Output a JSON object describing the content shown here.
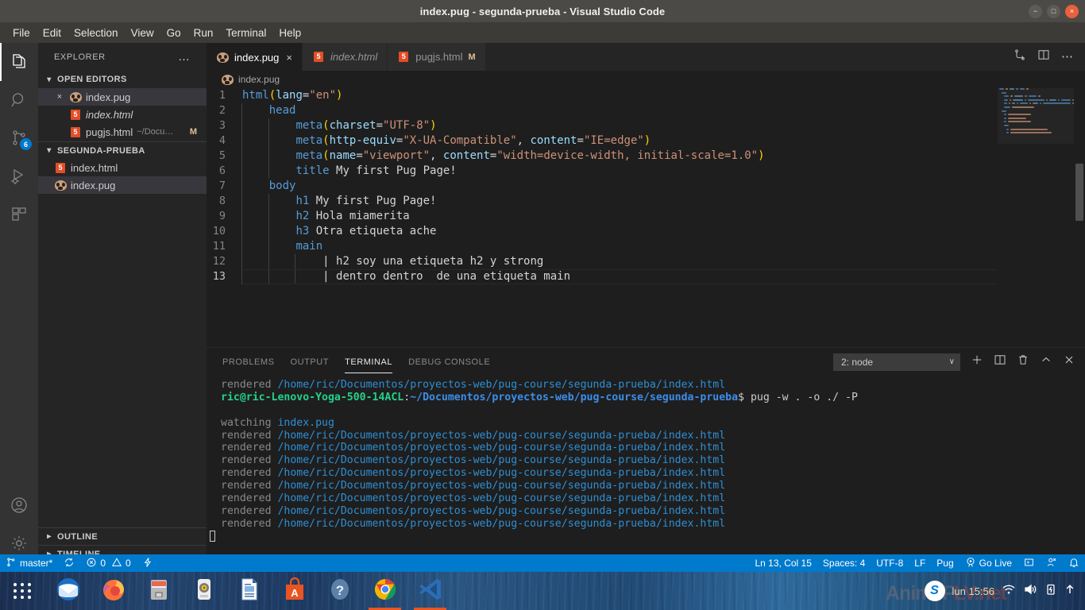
{
  "window": {
    "title": "index.pug - segunda-prueba - Visual Studio Code",
    "minimize": "−",
    "maximize": "□",
    "close": "×"
  },
  "menubar": {
    "items": [
      "File",
      "Edit",
      "Selection",
      "View",
      "Go",
      "Run",
      "Terminal",
      "Help"
    ]
  },
  "activitybar": {
    "items": [
      {
        "name": "explorer",
        "icon": "files-icon",
        "active": true,
        "badge": ""
      },
      {
        "name": "search",
        "icon": "search-icon",
        "active": false,
        "badge": ""
      },
      {
        "name": "source-control",
        "icon": "source-control-icon",
        "active": false,
        "badge": "6"
      },
      {
        "name": "run-and-debug",
        "icon": "run-debug-icon",
        "active": false,
        "badge": ""
      },
      {
        "name": "extensions",
        "icon": "extensions-icon",
        "active": false,
        "badge": ""
      }
    ],
    "bottom": [
      {
        "name": "accounts",
        "icon": "account-icon"
      },
      {
        "name": "settings",
        "icon": "gear-icon"
      }
    ]
  },
  "sidebar": {
    "title": "EXPLORER",
    "more_actions": "…",
    "open_editors": {
      "label": "OPEN EDITORS",
      "items": [
        {
          "name": "index.pug",
          "icon": "pug-icon",
          "selected": true,
          "italic": false,
          "close": "×",
          "detail": "",
          "badge": ""
        },
        {
          "name": "index.html",
          "icon": "html-icon",
          "selected": false,
          "italic": true,
          "close": "",
          "detail": "",
          "badge": ""
        },
        {
          "name": "pugjs.html",
          "icon": "html-icon",
          "selected": false,
          "italic": false,
          "close": "",
          "detail": "~/Docu…",
          "badge": "M"
        }
      ]
    },
    "folder": {
      "label": "SEGUNDA-PRUEBA",
      "items": [
        {
          "name": "index.html",
          "icon": "html-icon",
          "selected": false
        },
        {
          "name": "index.pug",
          "icon": "pug-icon",
          "selected": true
        }
      ]
    },
    "outline_label": "OUTLINE",
    "timeline_label": "TIMELINE"
  },
  "editor": {
    "tabs": [
      {
        "label": "index.pug",
        "icon": "pug-icon",
        "active": true,
        "italic": false,
        "close": "×",
        "modified": ""
      },
      {
        "label": "index.html",
        "icon": "html-icon",
        "active": false,
        "italic": true,
        "close": "",
        "modified": ""
      },
      {
        "label": "pugjs.html",
        "icon": "html-icon",
        "active": false,
        "italic": false,
        "close": "",
        "modified": "M"
      }
    ],
    "actions": [
      "split-terminal-icon",
      "split-editor-icon",
      "more-actions-icon"
    ],
    "breadcrumb": "index.pug",
    "language": "Pug",
    "lines": [
      {
        "n": 1,
        "indent": 0,
        "tokens": [
          {
            "t": "tag",
            "v": "html"
          },
          {
            "t": "paren",
            "v": "("
          },
          {
            "t": "attr",
            "v": "lang"
          },
          {
            "t": "punc",
            "v": "="
          },
          {
            "t": "str",
            "v": "\"en\""
          },
          {
            "t": "paren",
            "v": ")"
          }
        ]
      },
      {
        "n": 2,
        "indent": 1,
        "tokens": [
          {
            "t": "tag",
            "v": "head"
          }
        ]
      },
      {
        "n": 3,
        "indent": 2,
        "tokens": [
          {
            "t": "tag",
            "v": "meta"
          },
          {
            "t": "paren",
            "v": "("
          },
          {
            "t": "attr",
            "v": "charset"
          },
          {
            "t": "punc",
            "v": "="
          },
          {
            "t": "str",
            "v": "\"UTF-8\""
          },
          {
            "t": "paren",
            "v": ")"
          }
        ]
      },
      {
        "n": 4,
        "indent": 2,
        "tokens": [
          {
            "t": "tag",
            "v": "meta"
          },
          {
            "t": "paren",
            "v": "("
          },
          {
            "t": "attr",
            "v": "http-equiv"
          },
          {
            "t": "punc",
            "v": "="
          },
          {
            "t": "str",
            "v": "\"X-UA-Compatible\""
          },
          {
            "t": "punc",
            "v": ", "
          },
          {
            "t": "attr",
            "v": "content"
          },
          {
            "t": "punc",
            "v": "="
          },
          {
            "t": "str",
            "v": "\"IE=edge\""
          },
          {
            "t": "paren",
            "v": ")"
          }
        ]
      },
      {
        "n": 5,
        "indent": 2,
        "tokens": [
          {
            "t": "tag",
            "v": "meta"
          },
          {
            "t": "paren",
            "v": "("
          },
          {
            "t": "attr",
            "v": "name"
          },
          {
            "t": "punc",
            "v": "="
          },
          {
            "t": "str",
            "v": "\"viewport\""
          },
          {
            "t": "punc",
            "v": ", "
          },
          {
            "t": "attr",
            "v": "content"
          },
          {
            "t": "punc",
            "v": "="
          },
          {
            "t": "str",
            "v": "\"width=device-width, initial-scale=1.0\""
          },
          {
            "t": "paren",
            "v": ")"
          }
        ]
      },
      {
        "n": 6,
        "indent": 2,
        "tokens": [
          {
            "t": "tag",
            "v": "title"
          },
          {
            "t": "txt",
            "v": " My first Pug Page!"
          }
        ]
      },
      {
        "n": 7,
        "indent": 1,
        "tokens": [
          {
            "t": "tag",
            "v": "body"
          }
        ]
      },
      {
        "n": 8,
        "indent": 2,
        "tokens": [
          {
            "t": "tag",
            "v": "h1"
          },
          {
            "t": "txt",
            "v": " My first Pug Page!"
          }
        ]
      },
      {
        "n": 9,
        "indent": 2,
        "tokens": [
          {
            "t": "tag",
            "v": "h2"
          },
          {
            "t": "txt",
            "v": " Hola miamerita"
          }
        ]
      },
      {
        "n": 10,
        "indent": 2,
        "tokens": [
          {
            "t": "tag",
            "v": "h3"
          },
          {
            "t": "txt",
            "v": " Otra etiqueta ache"
          }
        ]
      },
      {
        "n": 11,
        "indent": 2,
        "tokens": [
          {
            "t": "tag",
            "v": "main"
          }
        ]
      },
      {
        "n": 12,
        "indent": 3,
        "tokens": [
          {
            "t": "pipe",
            "v": "| "
          },
          {
            "t": "txt",
            "v": "h2 soy una etiqueta h2 y strong"
          }
        ]
      },
      {
        "n": 13,
        "indent": 3,
        "tokens": [
          {
            "t": "pipe",
            "v": "| "
          },
          {
            "t": "txt",
            "v": "dentro dentro  de una etiqueta main"
          }
        ]
      }
    ]
  },
  "panel": {
    "tabs": [
      {
        "label": "PROBLEMS",
        "active": false
      },
      {
        "label": "OUTPUT",
        "active": false
      },
      {
        "label": "TERMINAL",
        "active": true
      },
      {
        "label": "DEBUG CONSOLE",
        "active": false
      }
    ],
    "terminal_select": "2: node",
    "select_caret": "∨",
    "actions": [
      "new-terminal-icon",
      "split-terminal-icon",
      "kill-terminal-icon",
      "maximize-panel-icon",
      "close-panel-icon"
    ],
    "terminal_lines": [
      {
        "type": "rendered",
        "label": "rendered",
        "path": "/home/ric/Documentos/proyectos-web/pug-course/segunda-prueba/index.html"
      },
      {
        "type": "prompt",
        "user": "ric@ric-Lenovo-Yoga-500-14ACL",
        "sep": ":",
        "path": "~/Documentos/proyectos-web/pug-course/segunda-prueba",
        "dollar": "$",
        "command": " pug -w . -o ./ -P"
      },
      {
        "type": "blank"
      },
      {
        "type": "watching",
        "label": "watching",
        "path": "index.pug"
      },
      {
        "type": "rendered",
        "label": "rendered",
        "path": "/home/ric/Documentos/proyectos-web/pug-course/segunda-prueba/index.html"
      },
      {
        "type": "rendered",
        "label": "rendered",
        "path": "/home/ric/Documentos/proyectos-web/pug-course/segunda-prueba/index.html"
      },
      {
        "type": "rendered",
        "label": "rendered",
        "path": "/home/ric/Documentos/proyectos-web/pug-course/segunda-prueba/index.html"
      },
      {
        "type": "rendered",
        "label": "rendered",
        "path": "/home/ric/Documentos/proyectos-web/pug-course/segunda-prueba/index.html"
      },
      {
        "type": "rendered",
        "label": "rendered",
        "path": "/home/ric/Documentos/proyectos-web/pug-course/segunda-prueba/index.html"
      },
      {
        "type": "rendered",
        "label": "rendered",
        "path": "/home/ric/Documentos/proyectos-web/pug-course/segunda-prueba/index.html"
      },
      {
        "type": "rendered",
        "label": "rendered",
        "path": "/home/ric/Documentos/proyectos-web/pug-course/segunda-prueba/index.html"
      },
      {
        "type": "rendered",
        "label": "rendered",
        "path": "/home/ric/Documentos/proyectos-web/pug-course/segunda-prueba/index.html"
      },
      {
        "type": "cursor"
      }
    ]
  },
  "statusbar": {
    "branch": "master*",
    "sync_icon": "sync-icon",
    "errors": "0",
    "warnings": "0",
    "ports_icon": "ports-icon",
    "position": "Ln 13, Col 15",
    "spaces": "Spaces: 4",
    "encoding": "UTF-8",
    "eol": "LF",
    "language": "Pug",
    "go_live": "Go Live",
    "remote_icon": "remote-window-icon",
    "feedback_icon": "feedback-icon",
    "bell_icon": "bell-icon",
    "accent": "#007acc"
  },
  "taskbar": {
    "items": [
      {
        "name": "show-applications",
        "icon": "grid-dots-icon"
      },
      {
        "name": "thunderbird",
        "icon": "thunderbird-icon"
      },
      {
        "name": "firefox",
        "icon": "firefox-icon"
      },
      {
        "name": "files",
        "icon": "files-manager-icon"
      },
      {
        "name": "rhythmbox",
        "icon": "rhythmbox-icon"
      },
      {
        "name": "libreoffice-writer",
        "icon": "libreoffice-icon"
      },
      {
        "name": "ubuntu-software",
        "icon": "ubuntu-software-icon"
      },
      {
        "name": "help",
        "icon": "help-icon"
      },
      {
        "name": "google-chrome",
        "icon": "chrome-icon",
        "running": true
      },
      {
        "name": "visual-studio-code",
        "icon": "vscode-icon",
        "running": true
      }
    ],
    "tray": {
      "skype": "S",
      "clock": "lun 15:56",
      "wifi_icon": "wifi-icon",
      "volume_icon": "volume-icon",
      "battery_icon": "battery-icon",
      "arrow_icon": "arrow-up-icon"
    },
    "watermark_left": "AnimeF",
    "watermark_right": "LV.net"
  }
}
